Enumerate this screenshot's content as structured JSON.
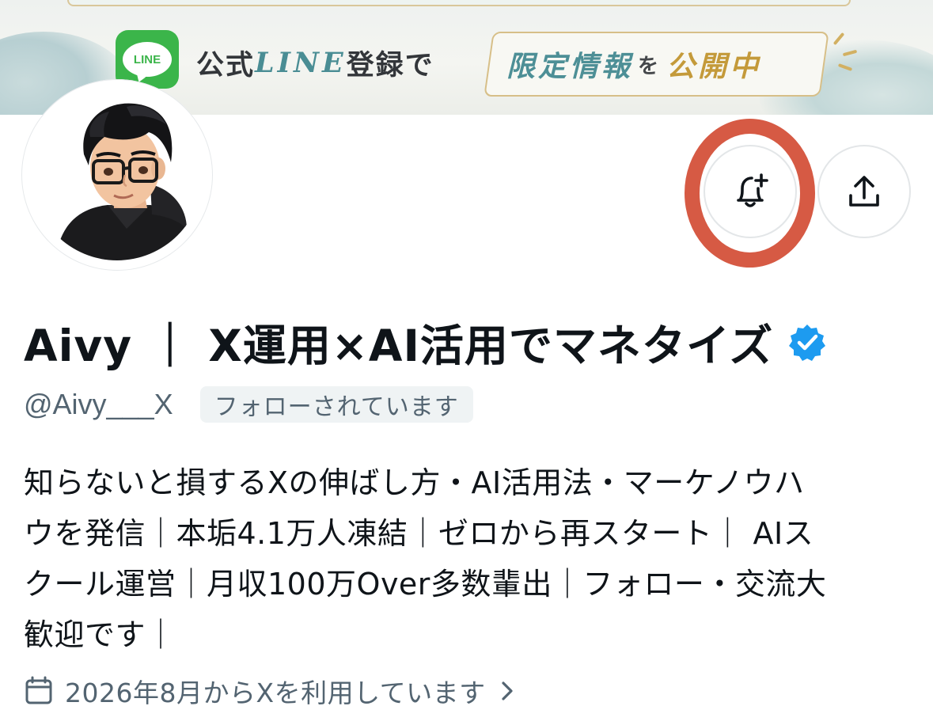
{
  "banner": {
    "line_logo_text": "LINE",
    "text_part1": "公式",
    "text_line": "LINE",
    "text_part2": "登録で",
    "pill_teal": "限定情報",
    "pill_small": "を",
    "pill_gold": "公開中"
  },
  "actions": {
    "notify_icon": "bell-plus-icon",
    "share_icon": "share-upload-icon"
  },
  "profile": {
    "display_name": "Aivy ｜ X運用×AI活用でマネタイズ",
    "verified_icon": "verified-badge-icon",
    "handle": "@Aivy___X",
    "follows_you": "フォローされています",
    "bio_lines": [
      "知らないと損するXの伸ばし方・AI活用法・マーケノウハ",
      "ウを発信｜本垢4.1万人凍結｜ゼロから再スタート｜ AIス",
      "クール運営｜月収100万Over多数輩出｜フォロー・交流大",
      "歓迎です｜"
    ],
    "joined_icon": "calendar-icon",
    "joined_text": "2026年8月からXを利用しています",
    "joined_chevron": "chevron-right-icon"
  },
  "colors": {
    "highlight_ring": "#d65a44",
    "verified": "#1d9bf0",
    "secondary_text": "#536471",
    "line_green": "#3bb54a"
  }
}
